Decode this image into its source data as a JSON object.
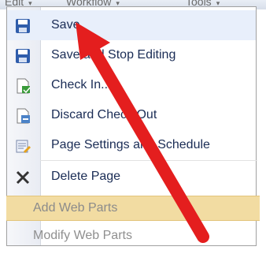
{
  "menubar": {
    "items": [
      "Edit",
      "Workflow",
      "Tools"
    ]
  },
  "menu": {
    "items": [
      {
        "label": "Save",
        "icon": "floppy-disk-icon"
      },
      {
        "label": "Save and Stop Editing",
        "icon": "floppy-disk-icon"
      },
      {
        "label": "Check In...",
        "icon": "check-in-icon"
      },
      {
        "label": "Discard Check Out",
        "icon": "discard-checkout-icon"
      },
      {
        "label": "Page Settings and Schedule",
        "icon": "page-settings-icon"
      },
      {
        "label": "Delete Page",
        "icon": "delete-x-icon"
      }
    ],
    "highlighted_item": {
      "label": "Add Web Parts"
    },
    "footer_item": {
      "label": "Modify Web Parts"
    }
  },
  "overlay": {
    "annotation": "red-arrow-pointing-to-save",
    "color": "#e41e1e"
  }
}
